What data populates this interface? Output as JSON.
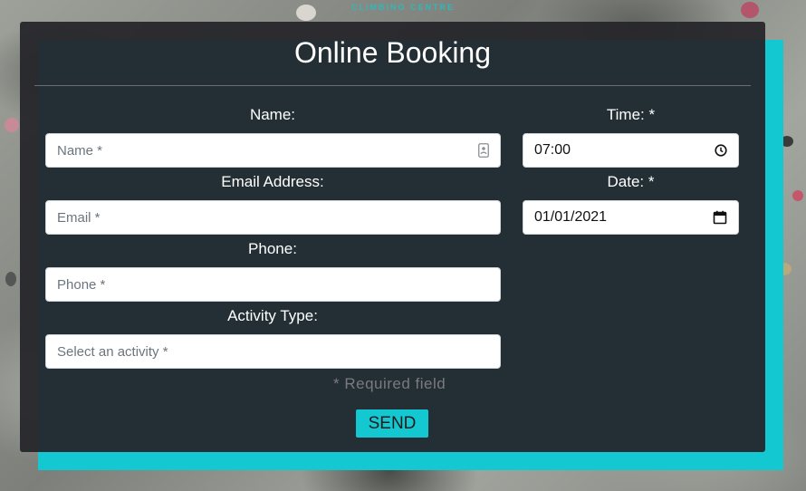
{
  "brand": {
    "text": "CLIMBING CENTRE"
  },
  "form": {
    "title": "Online Booking",
    "name": {
      "label": "Name:",
      "placeholder": "Name *"
    },
    "email": {
      "label": "Email Address:",
      "placeholder": "Email *"
    },
    "phone": {
      "label": "Phone:",
      "placeholder": "Phone *"
    },
    "activity": {
      "label": "Activity Type:",
      "placeholder": "Select an activity *"
    },
    "time": {
      "label": "Time: *",
      "value": "07:00"
    },
    "date": {
      "label": "Date: *",
      "value": "01/01/2021"
    },
    "required_note": "* Required field",
    "send_label": "SEND"
  },
  "icons": {
    "name_field": "contact-card-icon",
    "time_field": "clock-icon",
    "date_field": "calendar-icon"
  },
  "colors": {
    "accent": "#14c8d2",
    "card_bg": "#25252a",
    "label_text": "#ffffff",
    "muted_text": "#7a7a80"
  }
}
